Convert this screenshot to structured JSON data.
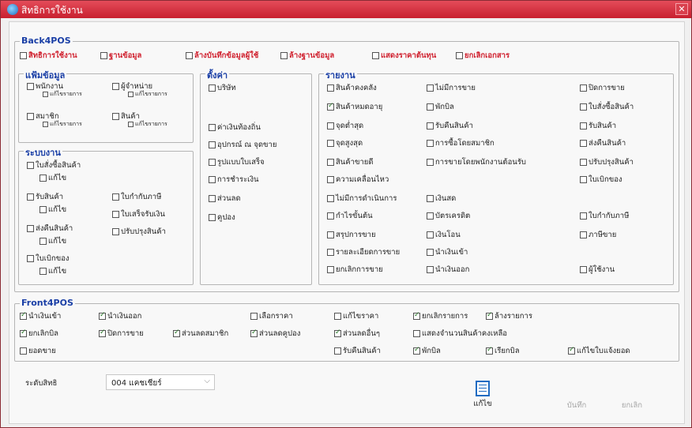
{
  "window": {
    "title": "สิทธิการใช้งาน",
    "close": "✕"
  },
  "back": {
    "title": "Back4POS",
    "top": [
      "สิทธิการใช้งาน",
      "ฐานข้อมูล",
      "ล้างบันทึกข้อมูลผู้ใช้",
      "ล้างฐานข้อมูล",
      "แสดงราคาต้นทุน",
      "ยกเลิกเอกสาร"
    ],
    "master": {
      "title": "แฟ้มข้อมูล",
      "items": [
        "พนักงาน",
        "ผู้จำหน่าย",
        "สมาชิก",
        "สินค้า"
      ],
      "sub": "แก้ไขรายการ"
    },
    "system": {
      "title": "ระบบงาน",
      "left": [
        "ใบสั่งซื้อสินค้า",
        "รับสินค้า",
        "ส่งคืนสินค้า",
        "ใบเบิกของ"
      ],
      "sub": "แก้ไข",
      "right": [
        "ใบกำกับภาษี",
        "ใบเสร็จรับเงิน",
        "ปรับปรุงสินค้า"
      ]
    },
    "settings": {
      "title": "ตั้งค่า",
      "items": [
        "บริษัท",
        "ค่าเงินท้องถิ่น",
        "อุปกรณ์ ณ จุดขาย",
        "รูปแบบใบเสร็จ",
        "การชำระเงิน",
        "ส่วนลด",
        "คูปอง"
      ]
    },
    "reports": {
      "title": "รายงาน",
      "col1": [
        "สินค้าคงคลัง",
        "สินค้าหมดอายุ",
        "จุดต่ำสุด",
        "จุดสูงสุด",
        "สินค้าขายดี",
        "ความเคลื่อนไหว",
        "ไม่มีการดำเนินการ",
        "กำไรขั้นต้น",
        "สรุปการขาย",
        "รายละเอียดการขาย",
        "ยกเลิกการขาย"
      ],
      "col1_checked": [
        false,
        true,
        false,
        false,
        false,
        false,
        false,
        false,
        false,
        false,
        false
      ],
      "col2": [
        "ไม่มีการขาย",
        "พักบิล",
        "รับคืนสินค้า",
        "การซื้อโดยสมาชิก",
        "การขายโดยพนักงานต้อนรับ",
        "เงินสด",
        "บัตรเครดิต",
        "เงินโอน",
        "นำเงินเข้า",
        "นำเงินออก"
      ],
      "col3": [
        "ปิดการขาย",
        "ใบสั่งซื้อสินค้า",
        "รับสินค้า",
        "ส่งคืนสินค้า",
        "ปรับปรุงสินค้า",
        "ใบเบิกของ",
        "ใบกำกับภาษี",
        "ภาษีขาย",
        "ผู้ใช้งาน"
      ]
    }
  },
  "front": {
    "title": "Front4POS",
    "items": [
      {
        "label": "นำเงินเข้า",
        "checked": true
      },
      {
        "label": "นำเงินออก",
        "checked": true
      },
      {
        "label": "เลือกราคา",
        "checked": false
      },
      {
        "label": "แก้ไขราคา",
        "checked": false
      },
      {
        "label": "ยกเลิกรายการ",
        "checked": true
      },
      {
        "label": "ล้างรายการ",
        "checked": true
      },
      {
        "label": "ยกเลิกบิล",
        "checked": true
      },
      {
        "label": "ปิดการขาย",
        "checked": true
      },
      {
        "label": "ส่วนลดสมาชิก",
        "checked": true
      },
      {
        "label": "ส่วนลดคูปอง",
        "checked": true
      },
      {
        "label": "ส่วนลดอื่นๆ",
        "checked": true
      },
      {
        "label": "แสดงจำนวนสินค้าคงเหลือ",
        "checked": false
      },
      {
        "label": "ยอดขาย",
        "checked": false
      },
      {
        "label": "รับคืนสินค้า",
        "checked": false
      },
      {
        "label": "พักบิล",
        "checked": true
      },
      {
        "label": "เรียกบิล",
        "checked": true
      },
      {
        "label": "แก้ไขใบแจ้งยอด",
        "checked": true
      }
    ]
  },
  "level": {
    "label": "ระดับสิทธิ",
    "value": "004 แคชเชียร์"
  },
  "buttons": {
    "edit": "แก้ไข",
    "save": "บันทึก",
    "cancel": "ยกเลิก"
  },
  "colors": {
    "titlebar": "#d22f3e",
    "accent": "#1a3fa6",
    "danger": "#d0212f"
  },
  "icons": {
    "edit": "edit-icon",
    "chevron": "chevron-down-icon",
    "close": "close-icon"
  }
}
